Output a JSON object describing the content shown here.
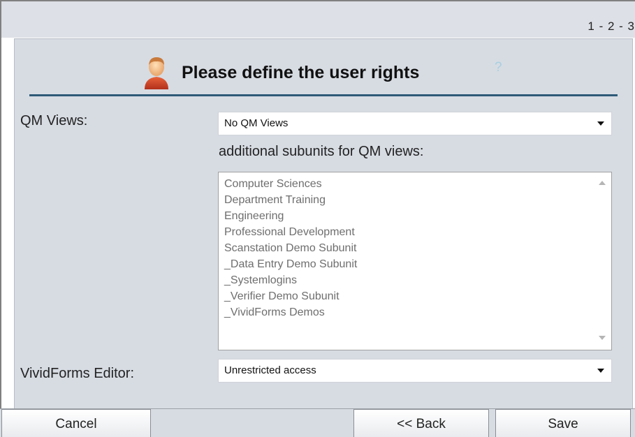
{
  "header": {
    "step_indicator": "1 - 2 - 3",
    "title": "Please define the user rights",
    "help_label": "?"
  },
  "form": {
    "qm_views": {
      "label": "QM Views:",
      "selected": "No QM Views"
    },
    "subunits": {
      "label": "additional subunits for QM views:",
      "items": [
        "Computer Sciences",
        "Department Training",
        "Engineering",
        "Professional Development",
        "Scanstation Demo Subunit",
        "_Data Entry Demo Subunit",
        "_Systemlogins",
        "_Verifier Demo Subunit",
        "_VividForms Demos"
      ]
    },
    "vividforms_editor": {
      "label": "VividForms Editor:",
      "selected": "Unrestricted access"
    }
  },
  "footer": {
    "cancel_label": "Cancel",
    "back_label": "<<  Back",
    "save_label": "Save"
  },
  "icons": {
    "user": "user-icon",
    "help": "help-icon",
    "dropdown": "chevron-down-icon"
  },
  "colors": {
    "panel_bg": "#d7dce3",
    "rule": "#2e5a78",
    "help": "#a9cfe0",
    "list_text": "#6e6e6e"
  }
}
